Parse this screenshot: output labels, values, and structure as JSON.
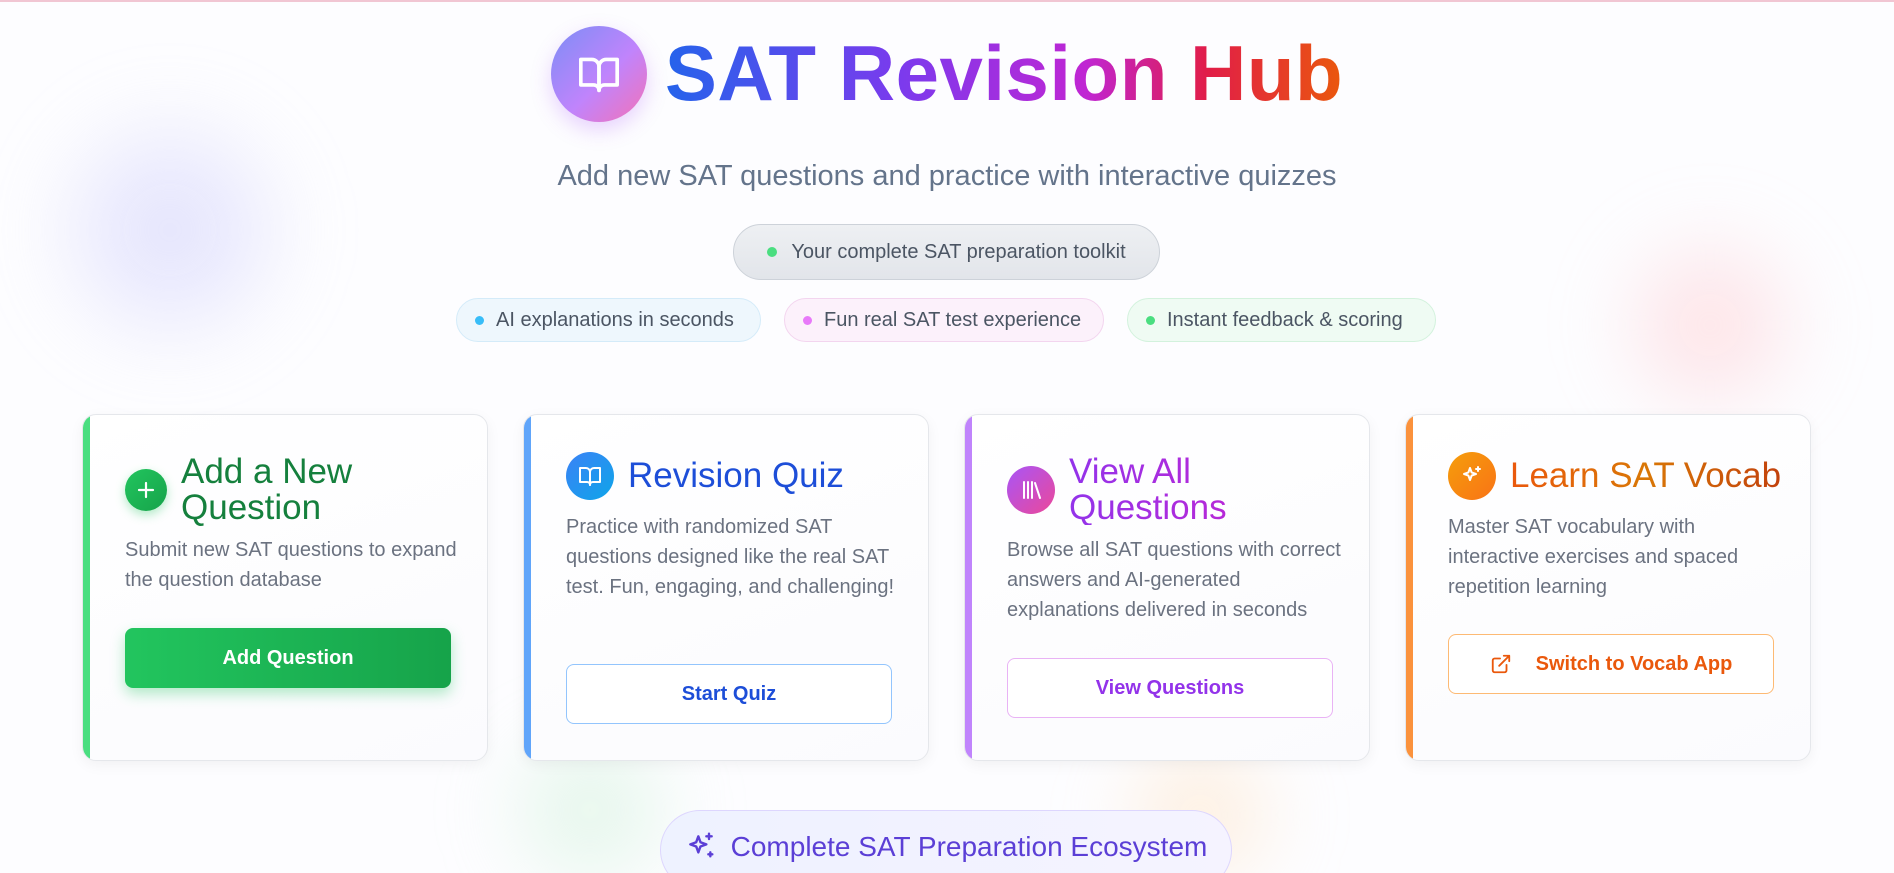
{
  "header": {
    "logo_icon": "open-book-icon",
    "title": "SAT Revision Hub",
    "subtitle": "Add new SAT questions and practice with interactive quizzes"
  },
  "toolkit_pill": {
    "text": "Your complete SAT preparation toolkit",
    "dot_color": "#4ade80"
  },
  "features": [
    {
      "text": "AI explanations in seconds",
      "dot_color": "#38bdf8"
    },
    {
      "text": "Fun real SAT test experience",
      "dot_color": "#e879f9"
    },
    {
      "text": "Instant feedback & scoring",
      "dot_color": "#4ade80"
    }
  ],
  "cards": [
    {
      "icon": "plus-icon",
      "title": "Add a New Question",
      "description": "Submit new SAT questions to expand the question database",
      "button": "Add Question",
      "accent": "#4ade80"
    },
    {
      "icon": "open-book-icon",
      "title": "Revision Quiz",
      "description": "Practice with randomized SAT questions designed like the real SAT test. Fun, engaging, and challenging!",
      "button": "Start Quiz",
      "accent": "#60a5fa"
    },
    {
      "icon": "library-icon",
      "title": "View All Questions",
      "description": "Browse all SAT questions with correct answers and AI-generated explanations delivered in seconds",
      "button": "View Questions",
      "accent": "#c084fc"
    },
    {
      "icon": "sparkle-icon",
      "title": "Learn SAT Vocab",
      "description": "Master SAT vocabulary with interactive exercises and spaced repetition learning",
      "button": "Switch to Vocab App",
      "button_icon": "external-link-icon",
      "accent": "#fb923c"
    }
  ],
  "ecosystem": {
    "icon": "sparkles-icon",
    "text": "Complete SAT Preparation Ecosystem"
  }
}
